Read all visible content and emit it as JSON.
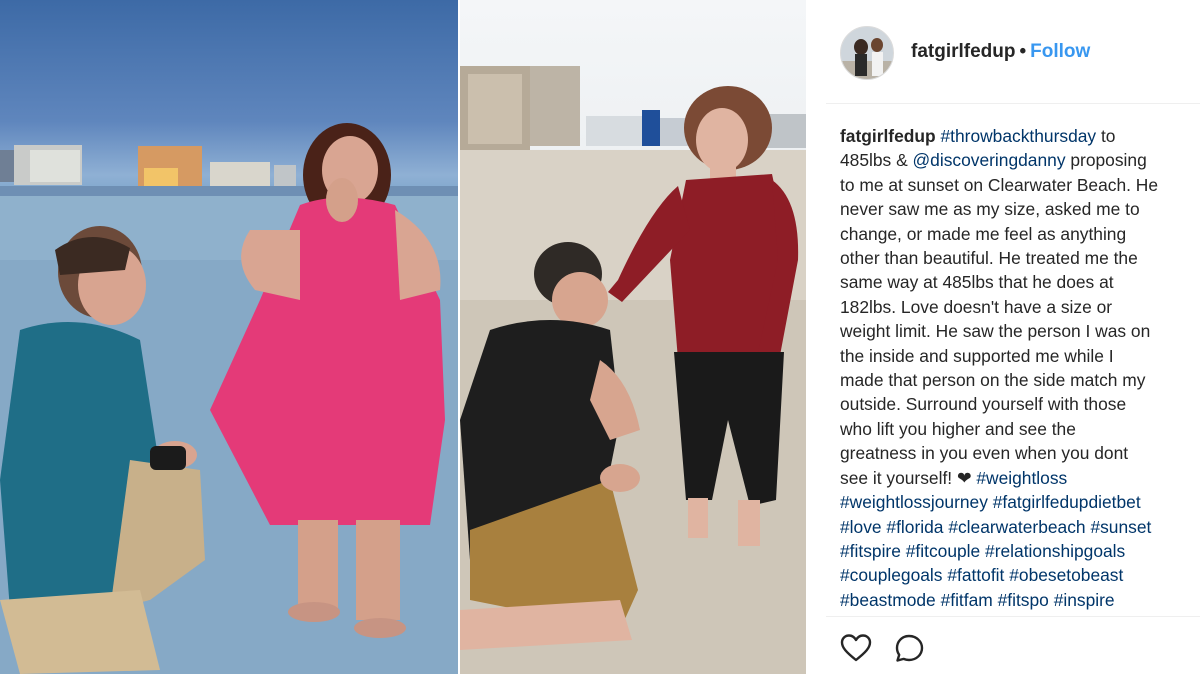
{
  "post": {
    "username": "fatgirlfedup",
    "separator": "•",
    "follow_label": "Follow"
  },
  "caption": {
    "lines": [
      [
        {
          "t": "fatgirlfedup",
          "k": "user"
        },
        {
          "t": " ",
          "k": "text"
        },
        {
          "t": "#throwbackthursday",
          "k": "tag"
        },
        {
          "t": " to",
          "k": "text"
        }
      ],
      [
        {
          "t": "485lbs & ",
          "k": "text"
        },
        {
          "t": "@discoveringdanny",
          "k": "tag"
        },
        {
          "t": " proposing",
          "k": "text"
        }
      ],
      [
        {
          "t": "to me at sunset on Clearwater Beach. He",
          "k": "text"
        }
      ],
      [
        {
          "t": "never saw me as my size, asked me to",
          "k": "text"
        }
      ],
      [
        {
          "t": "change, or made me feel as anything",
          "k": "text"
        }
      ],
      [
        {
          "t": "other than beautiful. He treated me the",
          "k": "text"
        }
      ],
      [
        {
          "t": "same way at 485lbs that he does at",
          "k": "text"
        }
      ],
      [
        {
          "t": "182lbs. Love doesn't have a size or",
          "k": "text"
        }
      ],
      [
        {
          "t": "weight limit. He saw the person I was on",
          "k": "text"
        }
      ],
      [
        {
          "t": "the inside and supported me while I",
          "k": "text"
        }
      ],
      [
        {
          "t": "made that person on the side match my",
          "k": "text"
        }
      ],
      [
        {
          "t": "outside. Surround yourself with those",
          "k": "text"
        }
      ],
      [
        {
          "t": "who lift you higher and see the",
          "k": "text"
        }
      ],
      [
        {
          "t": "greatness in you even when you dont",
          "k": "text"
        }
      ],
      [
        {
          "t": "see it yourself! ❤ ",
          "k": "text"
        },
        {
          "t": "#weightloss",
          "k": "tag"
        }
      ],
      [
        {
          "t": "#weightlossjourney",
          "k": "tag"
        },
        {
          "t": " ",
          "k": "text"
        },
        {
          "t": "#fatgirlfedupdietbet",
          "k": "tag"
        }
      ],
      [
        {
          "t": "#love",
          "k": "tag"
        },
        {
          "t": " ",
          "k": "text"
        },
        {
          "t": "#florida",
          "k": "tag"
        },
        {
          "t": " ",
          "k": "text"
        },
        {
          "t": "#clearwaterbeach",
          "k": "tag"
        },
        {
          "t": " ",
          "k": "text"
        },
        {
          "t": "#sunset",
          "k": "tag"
        }
      ],
      [
        {
          "t": "#fitspire",
          "k": "tag"
        },
        {
          "t": " ",
          "k": "text"
        },
        {
          "t": "#fitcouple",
          "k": "tag"
        },
        {
          "t": " ",
          "k": "text"
        },
        {
          "t": "#relationshipgoals",
          "k": "tag"
        }
      ],
      [
        {
          "t": "#couplegoals",
          "k": "tag"
        },
        {
          "t": " ",
          "k": "text"
        },
        {
          "t": "#fattofit",
          "k": "tag"
        },
        {
          "t": " ",
          "k": "text"
        },
        {
          "t": "#obesetobeast",
          "k": "tag"
        }
      ],
      [
        {
          "t": "#beastmode",
          "k": "tag"
        },
        {
          "t": " ",
          "k": "text"
        },
        {
          "t": "#fitfam",
          "k": "tag"
        },
        {
          "t": " ",
          "k": "text"
        },
        {
          "t": "#fitspo",
          "k": "tag"
        },
        {
          "t": " ",
          "k": "text"
        },
        {
          "t": "#inspire",
          "k": "tag"
        }
      ]
    ]
  },
  "actions": {
    "like_icon": "heart-icon",
    "comment_icon": "comment-icon"
  },
  "colors": {
    "link": "#3897f0",
    "hashtag": "#003569",
    "text": "#262626",
    "divider": "#efefef"
  }
}
